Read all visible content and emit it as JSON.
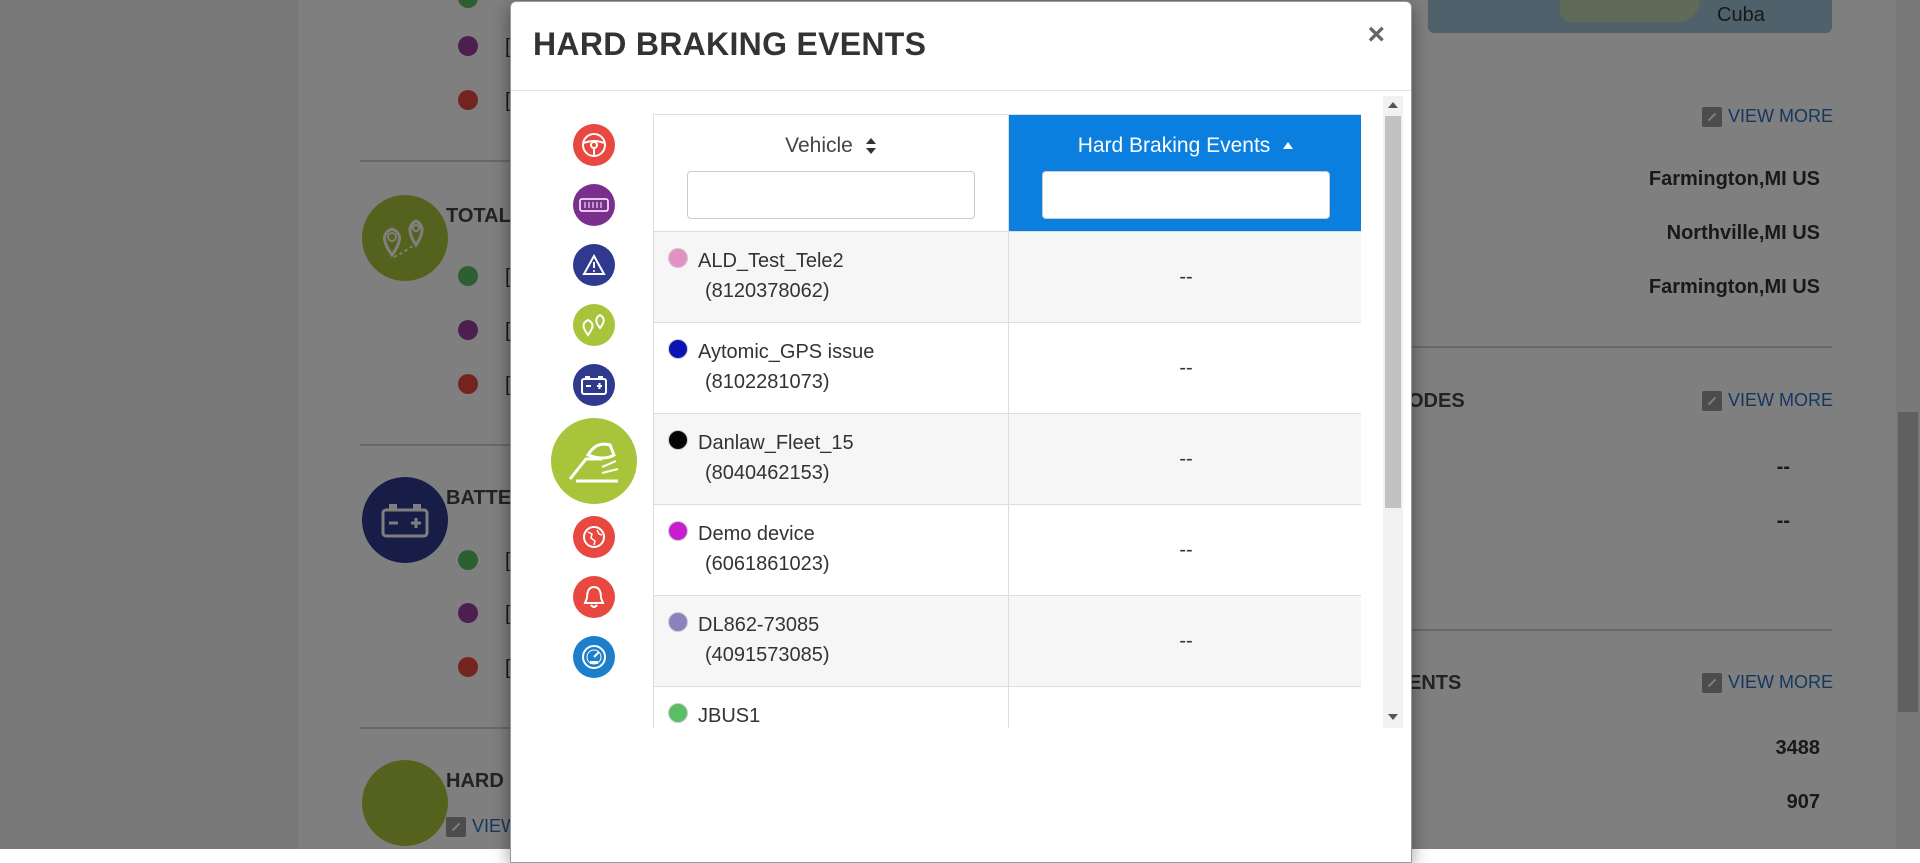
{
  "background": {
    "map_label": "Cuba",
    "headings": {
      "total": "TOTAL",
      "battery": "BATTE",
      "hard": "HARD",
      "codes": "ODES",
      "events": "ENTS"
    },
    "view_more": "VIEW MORE",
    "view_prefix": "VIEW",
    "locations": [
      "Farmington,MI US",
      "Northville,MI US",
      "Farmington,MI US"
    ],
    "dashes": [
      "--",
      "--"
    ],
    "counts": [
      "3488",
      "907"
    ],
    "bracket": "["
  },
  "modal": {
    "title": "HARD BRAKING EVENTS",
    "close": "×",
    "columns": {
      "vehicle": "Vehicle",
      "events": "Hard Braking Events"
    },
    "filters": {
      "vehicle_value": "",
      "events_value": ""
    },
    "sidebar_icons": [
      "steering-wheel-icon",
      "odometer-icon",
      "warning-icon",
      "trip-locations-icon",
      "battery-icon",
      "hard-braking-pedal-icon",
      "globe-icon",
      "alarm-bell-icon",
      "speedometer-icon"
    ],
    "rows": [
      {
        "name": "ALD_Test_Tele2",
        "id": "(8120378062)",
        "color": "#e191c4",
        "events": "--"
      },
      {
        "name": "Aytomic_GPS issue",
        "id": "(8102281073)",
        "color": "#0a14b4",
        "events": "--"
      },
      {
        "name": "Danlaw_Fleet_15",
        "id": "(8040462153)",
        "color": "#050505",
        "events": "--"
      },
      {
        "name": "Demo device",
        "id": "(6061861023)",
        "color": "#c81ed2",
        "events": "--"
      },
      {
        "name": "DL862-73085",
        "id": "(4091573085)",
        "color": "#8c82c0",
        "events": "--"
      },
      {
        "name": "JBUS1",
        "id": "",
        "color": "#5abe64",
        "events": ""
      }
    ]
  },
  "colors": {
    "header_active": "#0a7fe0",
    "red_icon": "#e8483f",
    "purple_icon": "#7a2f8f",
    "navy_icon": "#2f3a8f",
    "green_icon": "#a8c43a",
    "blue_icon": "#1d7fc9"
  }
}
